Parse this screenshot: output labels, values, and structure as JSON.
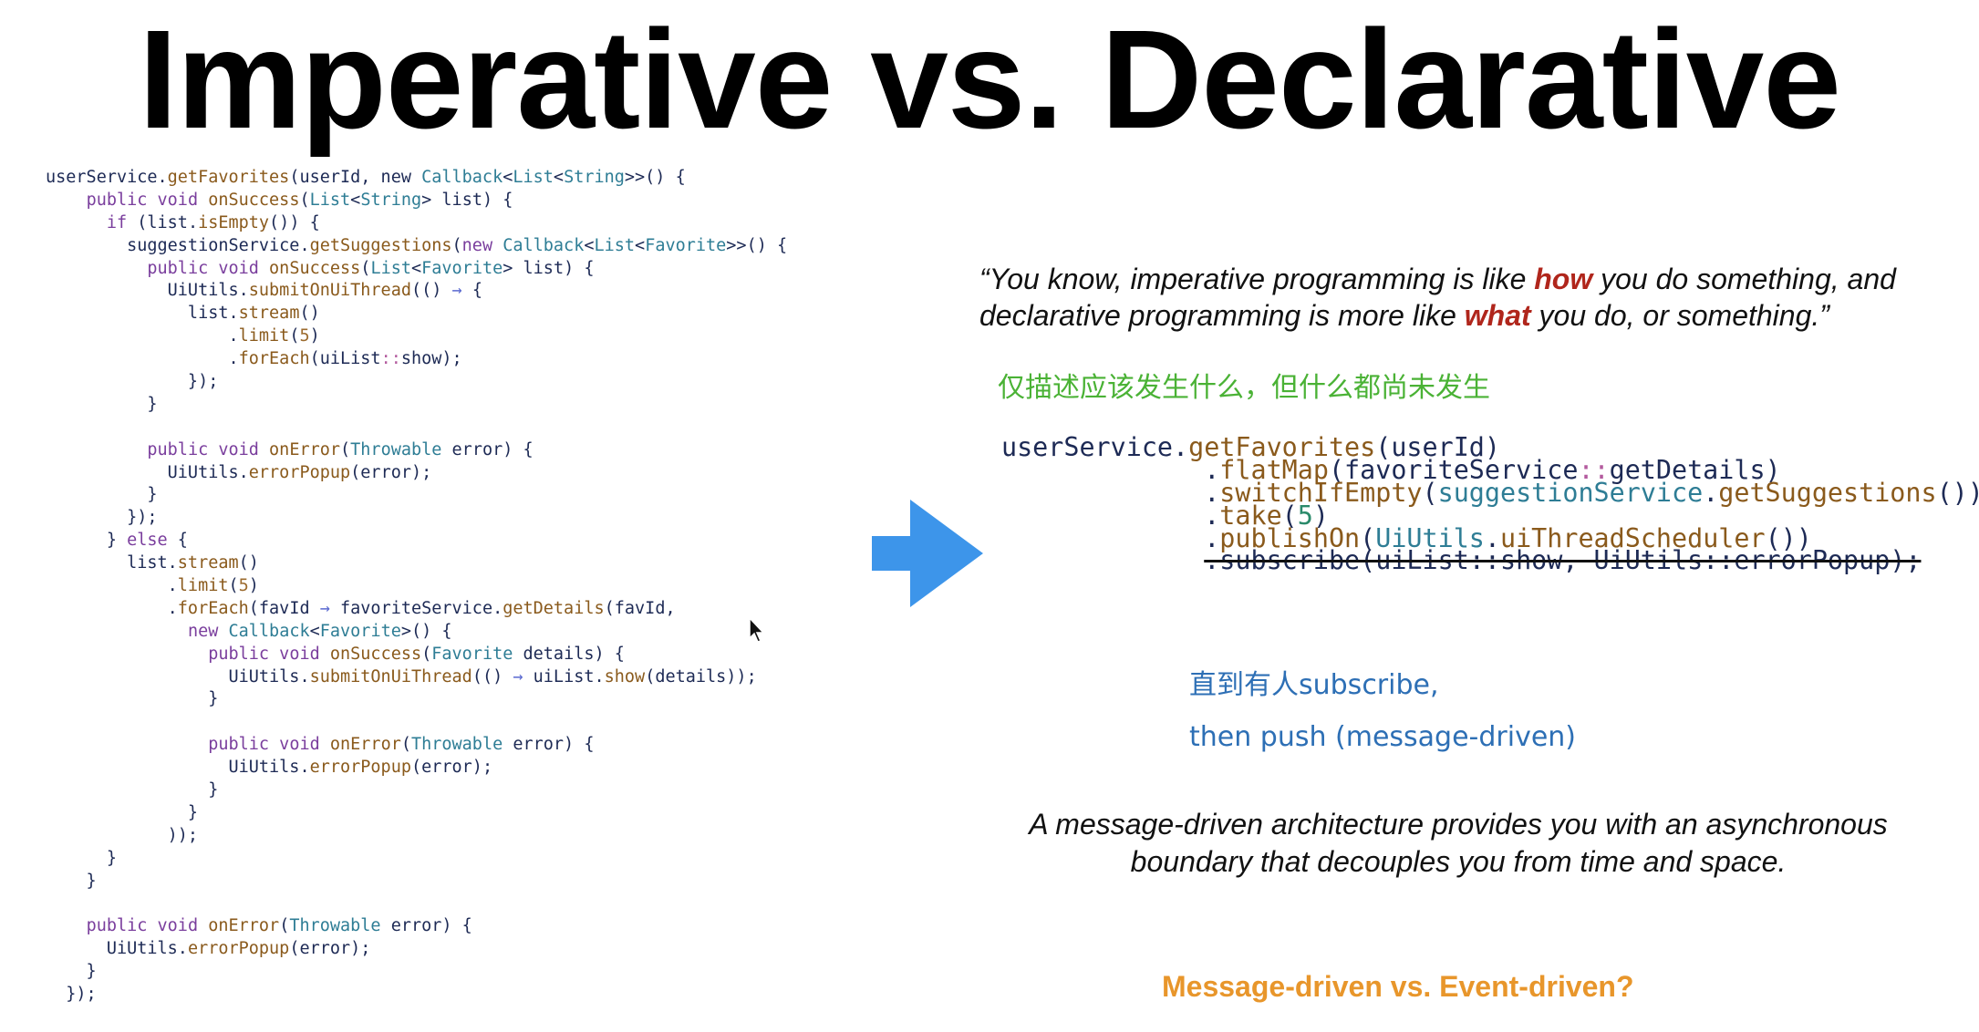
{
  "slide": {
    "title": "Imperative vs. Declarative"
  },
  "imperative_code": {
    "lines": [
      [
        [
          "k",
          "userService."
        ],
        [
          "fn",
          "getFavorites"
        ],
        [
          "k",
          "(userId, new "
        ],
        [
          "ty",
          "Callback"
        ],
        [
          "k",
          "<"
        ],
        [
          "ty",
          "List"
        ],
        [
          "k",
          "<"
        ],
        [
          "ty",
          "String"
        ],
        [
          "k",
          ">>() {"
        ]
      ],
      [
        [
          "k",
          "    "
        ],
        [
          "kw",
          "public void "
        ],
        [
          "fn",
          "onSuccess"
        ],
        [
          "k",
          "("
        ],
        [
          "ty",
          "List"
        ],
        [
          "k",
          "<"
        ],
        [
          "ty",
          "String"
        ],
        [
          "k",
          "> list) {"
        ]
      ],
      [
        [
          "k",
          "      "
        ],
        [
          "kw",
          "if "
        ],
        [
          "k",
          "(list."
        ],
        [
          "fn",
          "isEmpty"
        ],
        [
          "k",
          "()) {"
        ]
      ],
      [
        [
          "k",
          "        suggestionService."
        ],
        [
          "fn",
          "getSuggestions"
        ],
        [
          "k",
          "("
        ],
        [
          "kw",
          "new "
        ],
        [
          "ty",
          "Callback"
        ],
        [
          "k",
          "<"
        ],
        [
          "ty",
          "List"
        ],
        [
          "k",
          "<"
        ],
        [
          "ty",
          "Favorite"
        ],
        [
          "k",
          ">>() {"
        ]
      ],
      [
        [
          "k",
          "          "
        ],
        [
          "kw",
          "public void "
        ],
        [
          "fn",
          "onSuccess"
        ],
        [
          "k",
          "("
        ],
        [
          "ty",
          "List"
        ],
        [
          "k",
          "<"
        ],
        [
          "ty",
          "Favorite"
        ],
        [
          "k",
          "> list) {"
        ]
      ],
      [
        [
          "k",
          "            UiUtils."
        ],
        [
          "fn",
          "submitOnUiThread"
        ],
        [
          "k",
          "(() "
        ],
        [
          "op",
          "→"
        ],
        [
          "k",
          " {"
        ]
      ],
      [
        [
          "k",
          "              list."
        ],
        [
          "fn",
          "stream"
        ],
        [
          "k",
          "()"
        ]
      ],
      [
        [
          "k",
          "                  ."
        ],
        [
          "fn",
          "limit"
        ],
        [
          "k",
          "("
        ],
        [
          "nm",
          "5"
        ],
        [
          "k",
          ")"
        ]
      ],
      [
        [
          "k",
          "                  ."
        ],
        [
          "fn",
          "forEach"
        ],
        [
          "k",
          "(uiList"
        ],
        [
          "cc",
          "::"
        ],
        [
          "k",
          "show);"
        ]
      ],
      [
        [
          "k",
          "              });"
        ]
      ],
      [
        [
          "k",
          "          }"
        ]
      ],
      [
        [
          "k",
          ""
        ]
      ],
      [
        [
          "k",
          "          "
        ],
        [
          "kw",
          "public void "
        ],
        [
          "fn",
          "onError"
        ],
        [
          "k",
          "("
        ],
        [
          "ty",
          "Throwable"
        ],
        [
          "k",
          " error) {"
        ]
      ],
      [
        [
          "k",
          "            UiUtils."
        ],
        [
          "fn",
          "errorPopup"
        ],
        [
          "k",
          "(error);"
        ]
      ],
      [
        [
          "k",
          "          }"
        ]
      ],
      [
        [
          "k",
          "        });"
        ]
      ],
      [
        [
          "k",
          "      } "
        ],
        [
          "kw",
          "else"
        ],
        [
          "k",
          " {"
        ]
      ],
      [
        [
          "k",
          "        list."
        ],
        [
          "fn",
          "stream"
        ],
        [
          "k",
          "()"
        ]
      ],
      [
        [
          "k",
          "            ."
        ],
        [
          "fn",
          "limit"
        ],
        [
          "k",
          "("
        ],
        [
          "nm",
          "5"
        ],
        [
          "k",
          ")"
        ]
      ],
      [
        [
          "k",
          "            ."
        ],
        [
          "fn",
          "forEach"
        ],
        [
          "k",
          "(favId "
        ],
        [
          "op",
          "→"
        ],
        [
          "k",
          " favoriteService."
        ],
        [
          "fn",
          "getDetails"
        ],
        [
          "k",
          "(favId,"
        ]
      ],
      [
        [
          "k",
          "              "
        ],
        [
          "kw",
          "new "
        ],
        [
          "ty",
          "Callback"
        ],
        [
          "k",
          "<"
        ],
        [
          "ty",
          "Favorite"
        ],
        [
          "k",
          ">() {"
        ]
      ],
      [
        [
          "k",
          "                "
        ],
        [
          "kw",
          "public void "
        ],
        [
          "fn",
          "onSuccess"
        ],
        [
          "k",
          "("
        ],
        [
          "ty",
          "Favorite"
        ],
        [
          "k",
          " details) {"
        ]
      ],
      [
        [
          "k",
          "                  UiUtils."
        ],
        [
          "fn",
          "submitOnUiThread"
        ],
        [
          "k",
          "(() "
        ],
        [
          "op",
          "→"
        ],
        [
          "k",
          " uiList."
        ],
        [
          "fn",
          "show"
        ],
        [
          "k",
          "(details));"
        ]
      ],
      [
        [
          "k",
          "                }"
        ]
      ],
      [
        [
          "k",
          ""
        ]
      ],
      [
        [
          "k",
          "                "
        ],
        [
          "kw",
          "public void "
        ],
        [
          "fn",
          "onError"
        ],
        [
          "k",
          "("
        ],
        [
          "ty",
          "Throwable"
        ],
        [
          "k",
          " error) {"
        ]
      ],
      [
        [
          "k",
          "                  UiUtils."
        ],
        [
          "fn",
          "errorPopup"
        ],
        [
          "k",
          "(error);"
        ]
      ],
      [
        [
          "k",
          "                }"
        ]
      ],
      [
        [
          "k",
          "              }"
        ]
      ],
      [
        [
          "k",
          "            ));"
        ]
      ],
      [
        [
          "k",
          "      }"
        ]
      ],
      [
        [
          "k",
          "    }"
        ]
      ],
      [
        [
          "k",
          ""
        ]
      ],
      [
        [
          "k",
          "    "
        ],
        [
          "kw",
          "public void "
        ],
        [
          "fn",
          "onError"
        ],
        [
          "k",
          "("
        ],
        [
          "ty",
          "Throwable"
        ],
        [
          "k",
          " error) {"
        ]
      ],
      [
        [
          "k",
          "      UiUtils."
        ],
        [
          "fn",
          "errorPopup"
        ],
        [
          "k",
          "(error);"
        ]
      ],
      [
        [
          "k",
          "    }"
        ]
      ],
      [
        [
          "k",
          "  });"
        ]
      ]
    ]
  },
  "quote": {
    "part1": "“You know, imperative programming is like ",
    "em1": "how",
    "part2": " you do something, and declarative programming is more like ",
    "em2": "what",
    "part3": " you do, or something.”"
  },
  "note_green": "仅描述应该发生什么，但什么都尚未发生",
  "declarative_code": {
    "lines": [
      [
        [
          "k",
          "userService."
        ],
        [
          "fn",
          "getFavorites"
        ],
        [
          "k",
          "(userId)"
        ]
      ],
      [
        [
          "k",
          "             ."
        ],
        [
          "fn",
          "flatMap"
        ],
        [
          "k",
          "(favoriteService"
        ],
        [
          "cc",
          "::"
        ],
        [
          "k",
          "getDetails)"
        ]
      ],
      [
        [
          "k",
          "             ."
        ],
        [
          "fn",
          "switchIfEmpty"
        ],
        [
          "k",
          "("
        ],
        [
          "ty",
          "suggestionService"
        ],
        [
          "k",
          "."
        ],
        [
          "fn",
          "getSuggestions"
        ],
        [
          "k",
          "())"
        ]
      ],
      [
        [
          "k",
          "             ."
        ],
        [
          "fn",
          "take"
        ],
        [
          "k",
          "("
        ],
        [
          "nm",
          "5"
        ],
        [
          "k",
          ")"
        ]
      ],
      [
        [
          "k",
          "             ."
        ],
        [
          "fn",
          "publishOn"
        ],
        [
          "k",
          "("
        ],
        [
          "ty",
          "UiUtils"
        ],
        [
          "k",
          "."
        ],
        [
          "fn",
          "uiThreadScheduler"
        ],
        [
          "k",
          "())"
        ]
      ],
      [
        [
          "k",
          "             "
        ],
        [
          "strike",
          ".subscribe(uiList::show, UiUtils::errorPopup);"
        ]
      ]
    ]
  },
  "note_blue": {
    "line1": "直到有人subscribe,",
    "line2": "then push (message-driven)"
  },
  "summary": "A message-driven architecture provides you with an asynchronous boundary that decouples you from time and space.",
  "question": "Message-driven vs. Event-driven?",
  "colors": {
    "arrow": "#3d95ea",
    "emphasis": "#b0261c",
    "green_note": "#4ab235",
    "blue_note": "#2d6fb5",
    "question": "#e8962b"
  },
  "icons": {
    "arrow": "right-arrow-icon",
    "cursor": "mouse-pointer-icon"
  }
}
